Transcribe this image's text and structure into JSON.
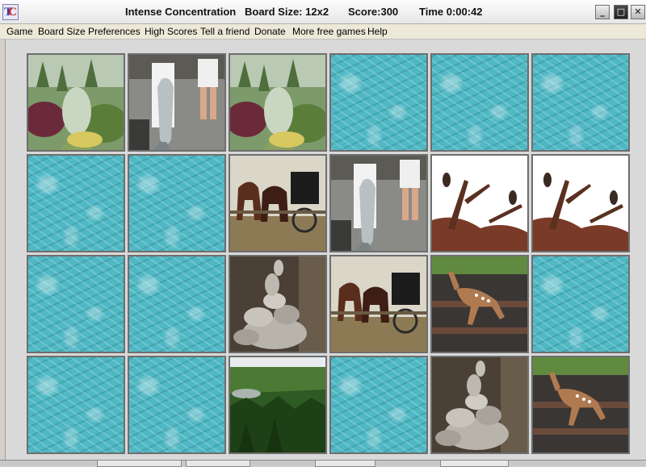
{
  "window": {
    "game_name": "Intense Concentration",
    "board_size": "Board Size: 12x2",
    "score": "Score:300",
    "time": "Time 0:00:42"
  },
  "icons": {
    "app": "tc-app-icon",
    "minimize": "minimize-icon",
    "maximize": "maximize-icon",
    "close": "close-icon"
  },
  "menu": [
    "Game",
    "Board Size",
    "Preferences",
    "High Scores",
    "Tell a friend",
    "Donate",
    "More free games",
    "Help"
  ],
  "board": {
    "rows": 4,
    "cols": 6,
    "tiles": [
      [
        "garden",
        "fisherman",
        "garden",
        "back",
        "back",
        "back"
      ],
      [
        "back",
        "back",
        "horses",
        "fisherman",
        "birds",
        "birds"
      ],
      [
        "back",
        "back",
        "rocks",
        "horses",
        "deer",
        "back"
      ],
      [
        "back",
        "back",
        "forest",
        "back",
        "rocks",
        "deer"
      ]
    ]
  },
  "colors": {
    "card_back": "#4fb8c4",
    "board_bg": "#d9d9d9"
  }
}
